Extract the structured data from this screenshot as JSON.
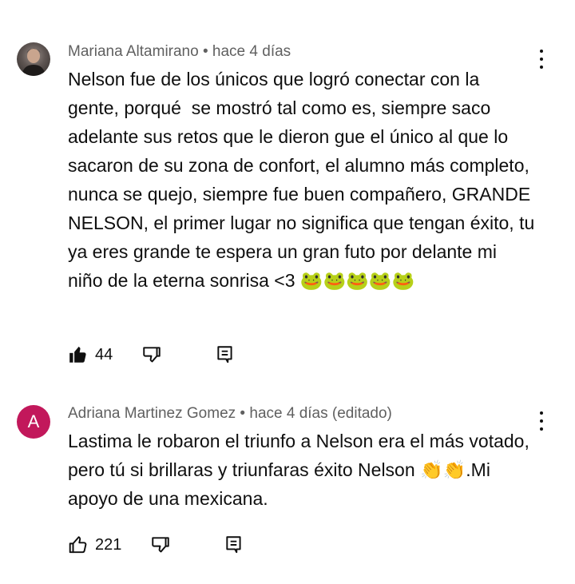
{
  "comments": [
    {
      "author": "Mariana Altamirano",
      "time": "hace 4 días",
      "text": "Nelson fue de los únicos que logró conectar con la gente, porqué  se mostró tal como es, siempre saco adelante sus retos que le dieron gue el único al que lo sacaron de su zona de confort, el alumno más completo, nunca se quejo, siempre fue buen compañero, GRANDE NELSON, el primer lugar no significa que tengan éxito, tu ya eres grande te espera un gran futo por delante mi niño de la eterna sonrisa <3 🐸🐸🐸🐸🐸",
      "likes": "44",
      "liked": true,
      "avatar_letter": ""
    },
    {
      "author": "Adriana Martinez Gomez",
      "time": "hace 4 días (editado)",
      "text": "Lastima le robaron el triunfo a Nelson era el más votado, pero tú si brillaras y triunfaras éxito Nelson 👏👏.Mi apoyo de una mexicana.",
      "likes": "221",
      "liked": false,
      "avatar_letter": "A",
      "avatar_color": "#c2185b"
    }
  ],
  "separator": " • "
}
